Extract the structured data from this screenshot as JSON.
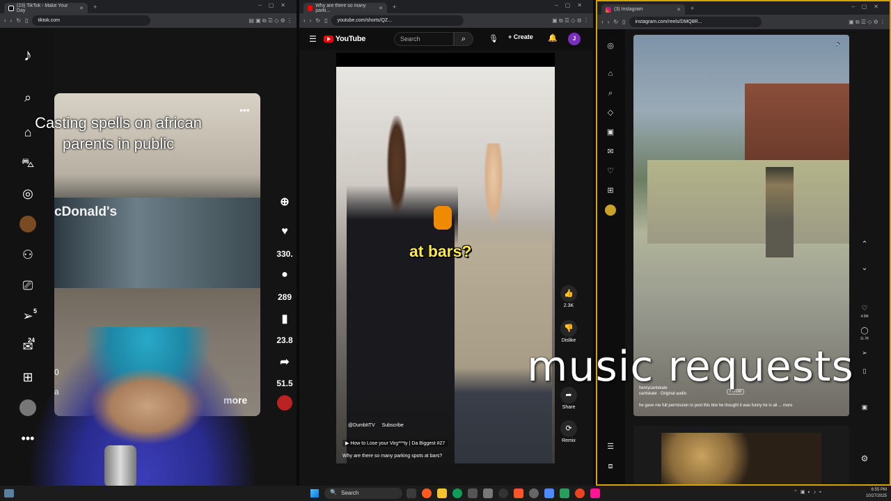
{
  "tiktok_window": {
    "tab_title": "(23) TikTok - Make Your Day",
    "url": "tiktok.com",
    "badges": {
      "inbox": "5",
      "messages": "24"
    },
    "video": {
      "caption_line1": "Casting spells on african",
      "caption_line2": "parents in public",
      "store_sign": "cDonald's",
      "more_label": "more",
      "left_counter": "0",
      "left_text": "a"
    },
    "actions": {
      "likes": "330.",
      "comments": "289",
      "saves": "23.8",
      "shares": "51.5"
    }
  },
  "youtube_window": {
    "tab_title": "Why are there so many parki...",
    "url": "youtube.com/shorts/QZ...",
    "header": {
      "logo": "YouTube",
      "search_placeholder": "Search",
      "create_label": "Create",
      "avatar_letter": "J"
    },
    "video": {
      "caption": "at bars?",
      "channel": "@DumbItTV",
      "subscribe": "Subscribe",
      "link": "How to Lose your Virg***ty | Da Biggest #27",
      "title": "Why are there so many parking spots at bars?"
    },
    "actions": {
      "likes": "2.3K",
      "dislike": "Dislike",
      "share": "Share",
      "remix": "Remix"
    }
  },
  "instagram_window": {
    "tab_title": "(3) Instagram",
    "url": "instagram.com/reels/DMQ8R...",
    "reel": {
      "username": "henrycantskate",
      "audio": "cantskate · Original audio",
      "follow": "Follow",
      "description": "he gave me full permission to post this btw he thought it was funny he is all ... more"
    },
    "actions": {
      "likes": "4.5M",
      "comments": "11.7K"
    }
  },
  "overlay_text": "music requests",
  "taskbar": {
    "search_placeholder": "Search",
    "time": "6:55 PM",
    "date": "10/27/2025"
  }
}
